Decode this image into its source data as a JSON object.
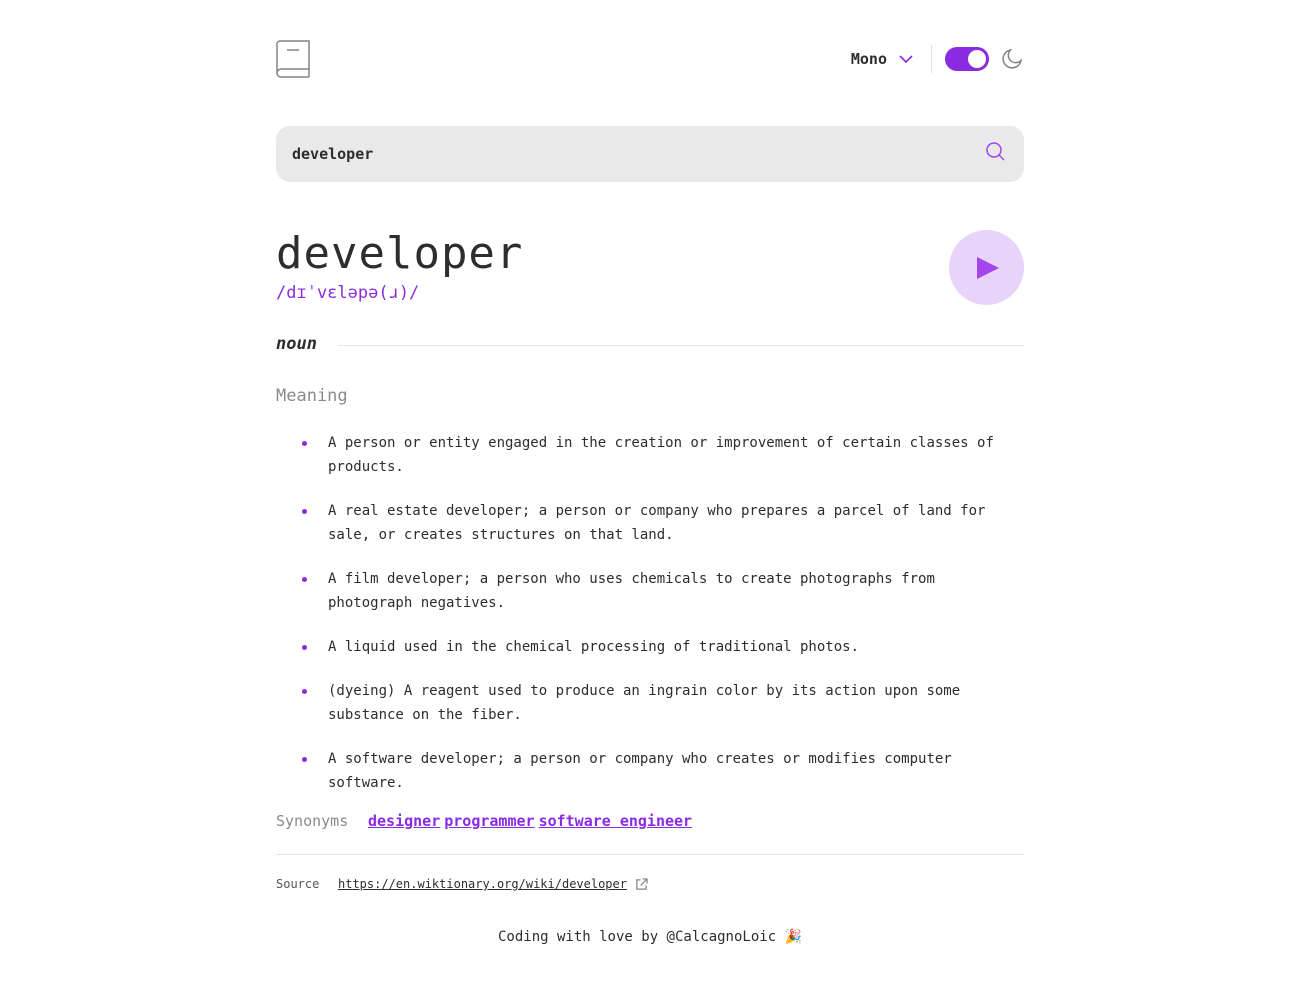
{
  "header": {
    "font_selected": "Mono",
    "theme_dark": true
  },
  "search": {
    "value": "developer"
  },
  "entry": {
    "word": "developer",
    "phonetic": "/dɪˈvɛləpə(ɹ)/",
    "part_of_speech": "noun",
    "meaning_title": "Meaning",
    "definitions": [
      "A person or entity engaged in the creation or improvement of certain classes of products.",
      "A real estate developer; a person or company who prepares a parcel of land for sale, or creates structures on that land.",
      "A film developer; a person who uses chemicals to create photographs from photograph negatives.",
      "A liquid used in the chemical processing of traditional photos.",
      "(dyeing) A reagent used to produce an ingrain color by its action upon some substance on the fiber.",
      "A software developer; a person or company who creates or modifies computer software."
    ],
    "synonyms_label": "Synonyms",
    "synonyms": [
      "designer",
      "programmer",
      "software engineer"
    ]
  },
  "source": {
    "label": "Source",
    "url": "https://en.wiktionary.org/wiki/developer"
  },
  "footer": {
    "text": "Coding with love by @CalcagnoLoic 🎉"
  },
  "colors": {
    "accent": "#8a2be2",
    "play_bg": "#e8d3fb",
    "search_bg": "#e9e9e9"
  },
  "icons": {
    "logo": "book-icon",
    "font_dropdown": "chevron-down-icon",
    "theme": "moon-icon",
    "search": "search-icon",
    "play": "play-icon",
    "external": "external-link-icon"
  }
}
